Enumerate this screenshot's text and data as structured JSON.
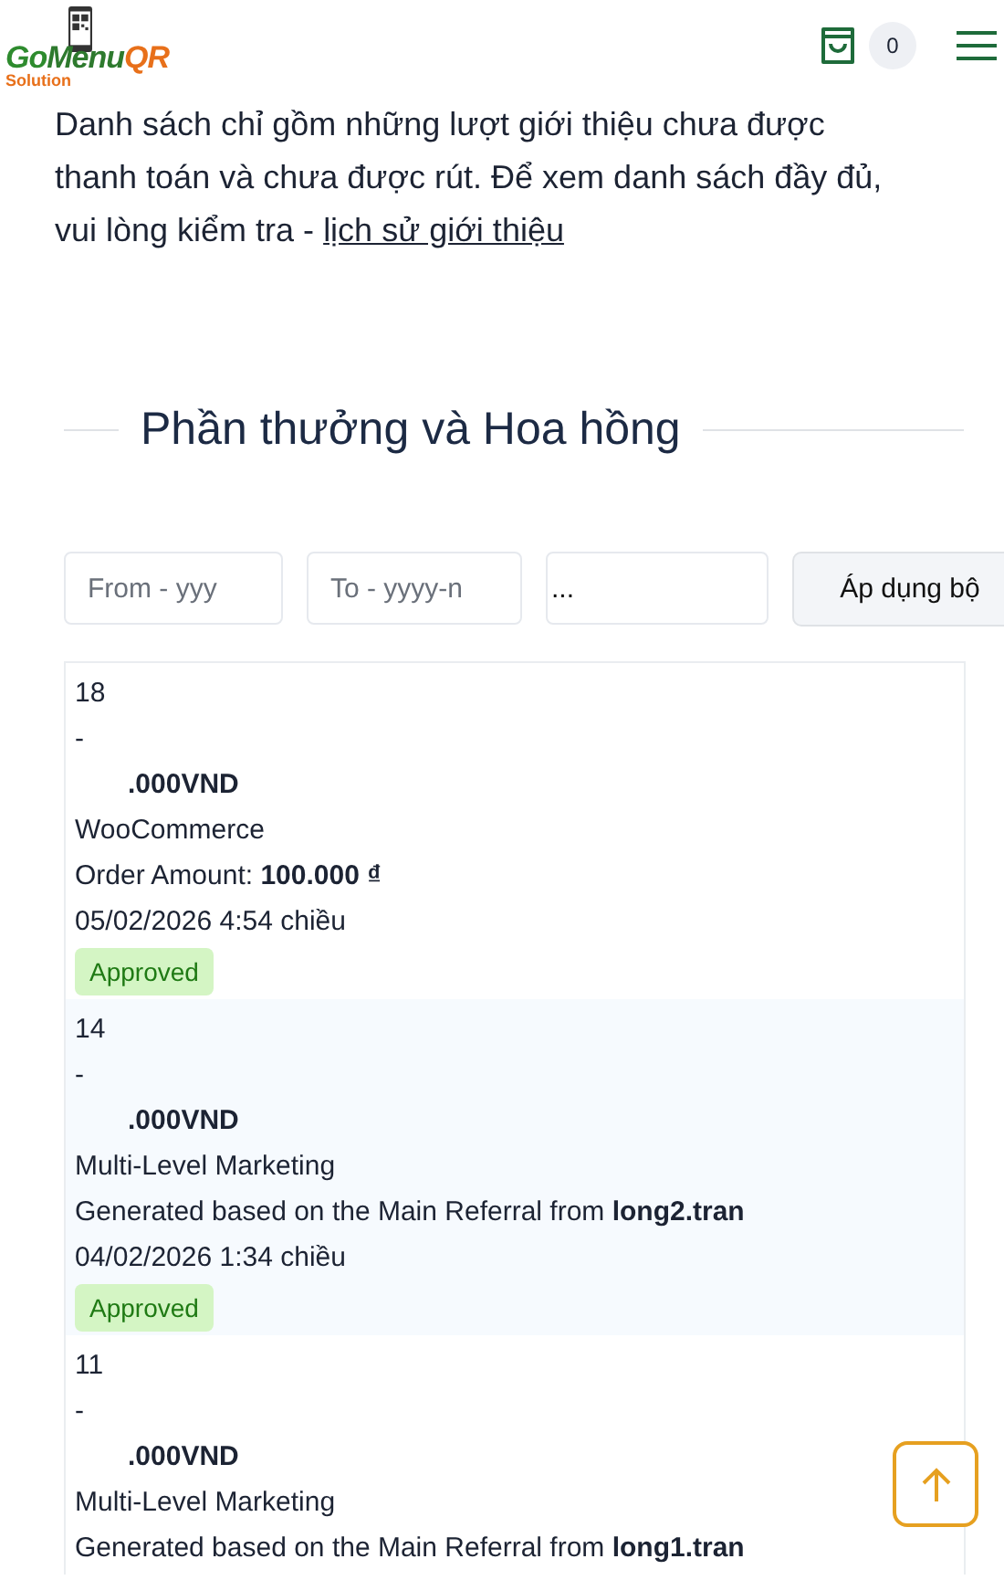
{
  "header": {
    "logo": {
      "parts": [
        "Go",
        "Menu",
        "QR"
      ],
      "tagline": "Solution"
    },
    "cart_count": "0"
  },
  "intro": {
    "text": "Danh sách chỉ gồm những lượt giới thiệu chưa được thanh toán và chưa được rút. Để xem danh sách đầy đủ, vui lòng kiểm tra - ",
    "link": "lịch sử giới thiệu"
  },
  "section_title": "Phần thưởng và Hoa hồng",
  "filters": {
    "from": {
      "placeholder": "From - yyy"
    },
    "to": {
      "placeholder": "To - yyyy-n"
    },
    "search": {
      "value": "..."
    },
    "apply_button": "Áp dụng bộ"
  },
  "commissions": [
    {
      "id": "18",
      "dash": "-",
      "amount": ".000VND",
      "source": "WooCommerce",
      "detail": "Order Amount: **100.000 ₫**",
      "date": "05/02/2026 4:54 chiều",
      "status": {
        "label": "Approved",
        "kind": "approved"
      }
    },
    {
      "id": "14",
      "dash": "-",
      "amount": ".000VND",
      "source": "Multi-Level Marketing",
      "detail": "Generated based on the Main Referral from **long2.tran**",
      "date": "04/02/2026 1:34 chiều",
      "status": {
        "label": "Approved",
        "kind": "approved"
      }
    },
    {
      "id": "11",
      "dash": "-",
      "amount": ".000VND",
      "source": "Multi-Level Marketing",
      "detail": "Generated based on the Main Referral from **long1.tran**"
    }
  ]
}
